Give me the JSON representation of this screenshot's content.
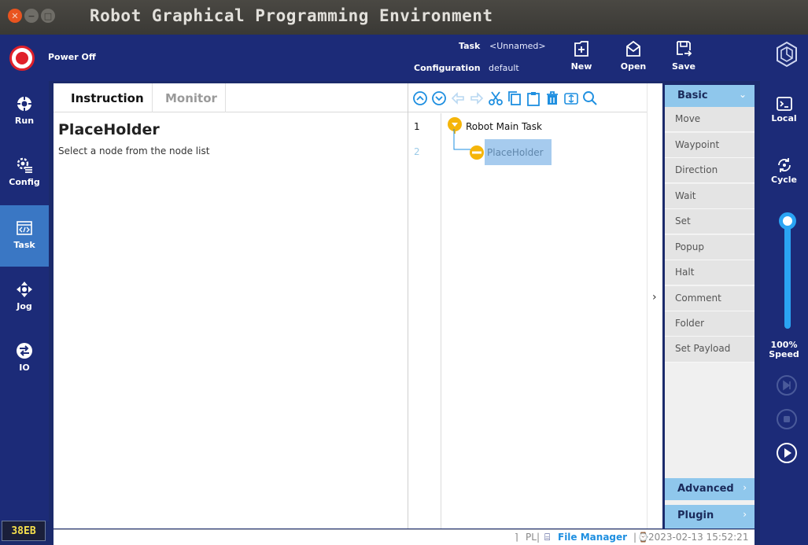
{
  "window": {
    "title": "Robot Graphical Programming Environment"
  },
  "header": {
    "power_status": "Power Off",
    "task_label": "Task",
    "task_value": "<Unnamed>",
    "config_label": "Configuration",
    "config_value": "default",
    "new_label": "New",
    "open_label": "Open",
    "save_label": "Save"
  },
  "nav": {
    "items": [
      {
        "label": "Run",
        "icon": "target-icon"
      },
      {
        "label": "Config",
        "icon": "gear-list-icon"
      },
      {
        "label": "Task",
        "icon": "code-window-icon"
      },
      {
        "label": "Jog",
        "icon": "move-arrows-icon"
      },
      {
        "label": "IO",
        "icon": "io-exchange-icon"
      }
    ],
    "active": "Task",
    "version": "38EB"
  },
  "tabs": {
    "instruction": "Instruction",
    "monitor": "Monitor"
  },
  "instruction": {
    "title": "PlaceHolder",
    "hint": "Select a node from the node list"
  },
  "tree": {
    "lines": [
      "1",
      "2"
    ],
    "root": "Robot Main Task",
    "child": "PlaceHolder"
  },
  "palette": {
    "basic_label": "Basic",
    "items": [
      "Move",
      "Waypoint",
      "Direction",
      "Wait",
      "Set",
      "Popup",
      "Halt",
      "Comment",
      "Folder",
      "Set Payload"
    ],
    "advanced_label": "Advanced",
    "plugin_label": "Plugin"
  },
  "rightbar": {
    "local_label": "Local",
    "cycle_label": "Cycle",
    "speed_percent": "100%",
    "speed_label": "Speed",
    "speed_value": 1.0
  },
  "status": {
    "pl": "PL",
    "file_manager": "File Manager",
    "datetime": "2023-02-13 15:52:21"
  },
  "colors": {
    "navy": "#1c2b78",
    "active_nav": "#3a77c4",
    "palette_head": "#8fc7ec",
    "accent_blue": "#2aa4f4",
    "power_red": "#e0202a",
    "node_yellow": "#f5b50a"
  }
}
